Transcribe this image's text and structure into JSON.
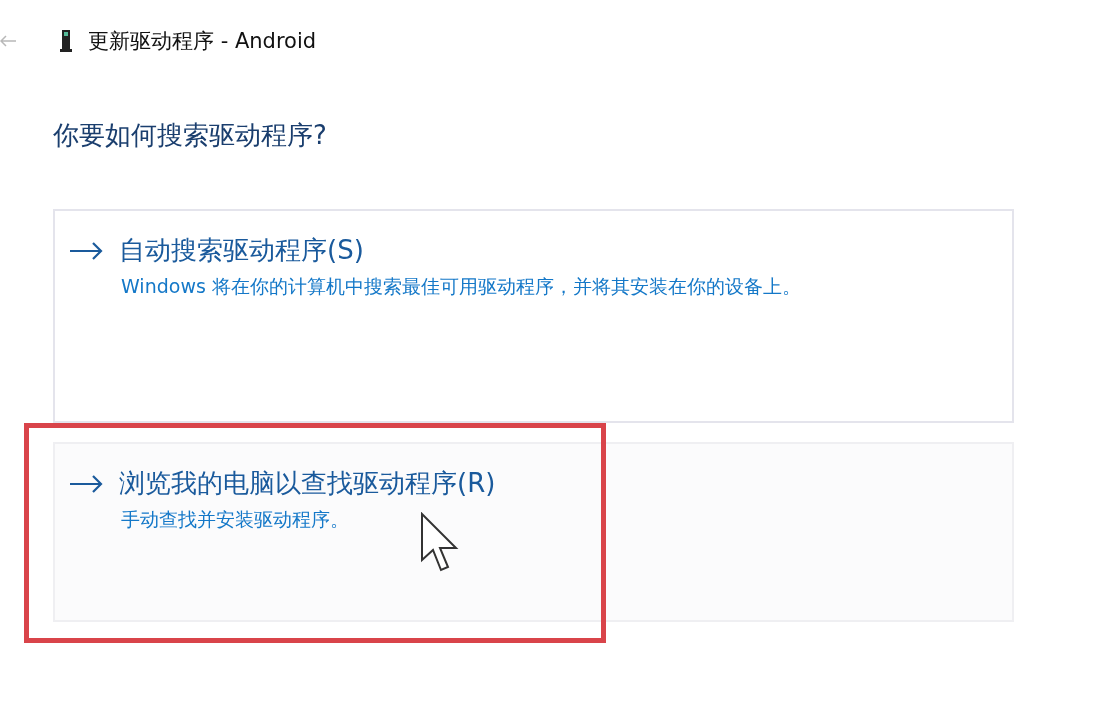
{
  "window": {
    "title": "更新驱动程序 - Android"
  },
  "heading": "你要如何搜索驱动程序?",
  "options": [
    {
      "title": "自动搜索驱动程序(S)",
      "description": "Windows 将在你的计算机中搜索最佳可用驱动程序，并将其安装在你的设备上。",
      "hovered": false,
      "highlighted": false
    },
    {
      "title": "浏览我的电脑以查找驱动程序(R)",
      "description": "手动查找并安装驱动程序。",
      "hovered": true,
      "highlighted": true
    }
  ]
}
